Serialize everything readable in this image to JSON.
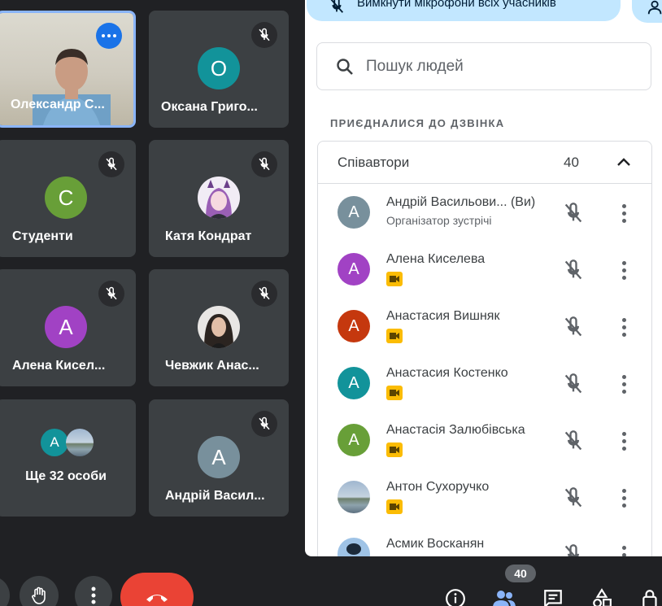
{
  "tiles": [
    {
      "name": "Олександр С...",
      "type": "video"
    },
    {
      "name": "Оксана Григо...",
      "initial": "О",
      "color": "#12939a"
    },
    {
      "name": "Студенти",
      "initial": "С",
      "color": "#689f38"
    },
    {
      "name": "Катя Кондрат",
      "type": "photo"
    },
    {
      "name": "Алена Кисел...",
      "initial": "А",
      "color": "#a142c4"
    },
    {
      "name": "Чевжик Анас...",
      "type": "photo"
    },
    {
      "name": "Ще 32 особи",
      "type": "more"
    },
    {
      "name": "Андрій Васил...",
      "initial": "А",
      "color": "#78909c"
    }
  ],
  "more_people": {
    "initial": "А",
    "color": "#12939a"
  },
  "panel": {
    "mute_all_label": "Вимкнути мікрофони всіх учасників",
    "search_placeholder": "Пошук людей",
    "section_label": "ПРИЄДНАЛИСЯ ДО ДЗВІНКА",
    "group": {
      "title": "Співавтори",
      "count": "40"
    },
    "people": [
      {
        "initial": "А",
        "color": "#78909c",
        "name": "Андрій Васильови...  (Ви)",
        "subtitle": "Організатор зустрічі"
      },
      {
        "initial": "А",
        "color": "#a142c4",
        "name": "Алена Киселева"
      },
      {
        "initial": "А",
        "color": "#c5380e",
        "name": "Анастасия Вишняк"
      },
      {
        "initial": "А",
        "color": "#12939a",
        "name": "Анастасия Костенко"
      },
      {
        "initial": "А",
        "color": "#689f38",
        "name": "Анастасія Залюбівська"
      },
      {
        "initial": "",
        "color": "#8ea3ad",
        "name": "Антон Сухоручко",
        "photo": true
      },
      {
        "initial": "",
        "color": "#3c5a7a",
        "name": "Асмик Восканян",
        "photo": true
      }
    ]
  },
  "bottom_bar": {
    "participant_count": "40"
  },
  "colors": {
    "accent": "#1a73e8",
    "end_call": "#ea4335",
    "tile_bg": "#3c4043",
    "pill": "#c2e7ff"
  }
}
